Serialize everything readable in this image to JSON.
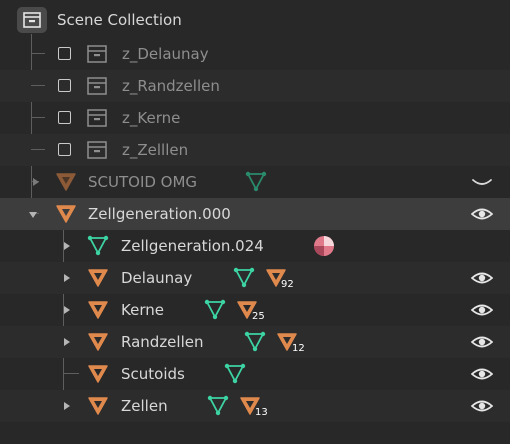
{
  "root": {
    "label": "Scene Collection",
    "icon": "scene-collection-icon"
  },
  "excluded_collections": [
    {
      "label": "z_Delaunay"
    },
    {
      "label": "z_Randzellen"
    },
    {
      "label": "z_Kerne"
    },
    {
      "label": "z_Zelllen"
    }
  ],
  "scutoid": {
    "label": "SCUTOID OMG"
  },
  "zellgeneration": {
    "label": "Zellgeneration.000",
    "children": [
      {
        "label": "Zellgeneration.024"
      },
      {
        "label": "Delaunay",
        "badge": "92"
      },
      {
        "label": "Kerne",
        "badge": "25"
      },
      {
        "label": "Randzellen",
        "badge": "12"
      },
      {
        "label": "Scutoids"
      },
      {
        "label": "Zellen",
        "badge": "13"
      }
    ]
  },
  "colors": {
    "mesh_object": "#e0894d",
    "mesh_data": "#3dd4a4",
    "material": "#e07a8a",
    "background": "#282828",
    "selected_row": "#3d3d3d"
  }
}
